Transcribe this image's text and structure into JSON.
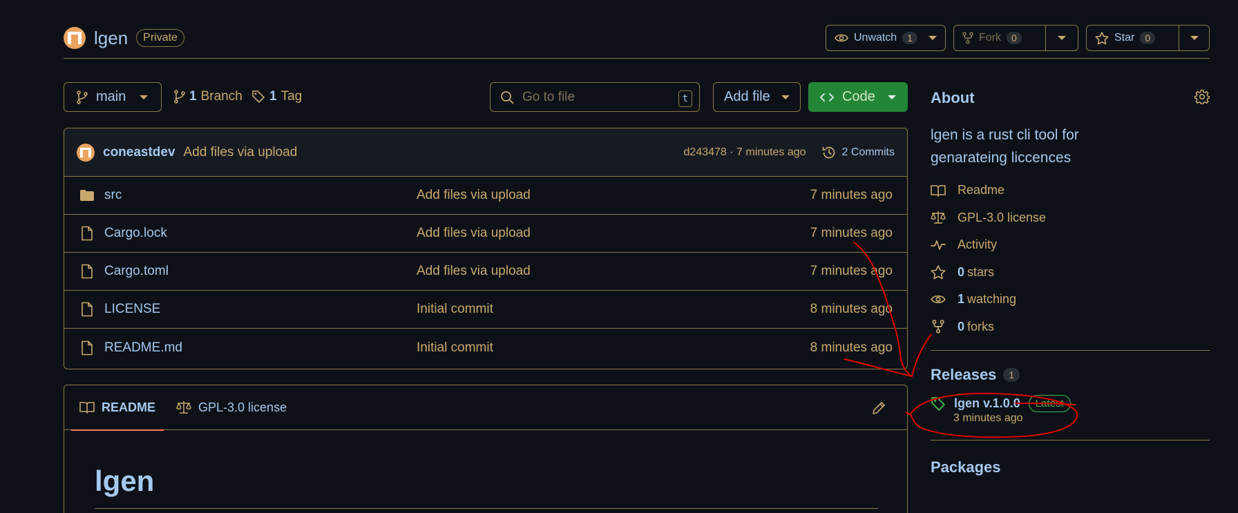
{
  "repo": {
    "name": "lgen",
    "visibility": "Private"
  },
  "header_buttons": {
    "unwatch_label": "Unwatch",
    "unwatch_count": "1",
    "fork_label": "Fork",
    "fork_count": "0",
    "star_label": "Star",
    "star_count": "0"
  },
  "toolbar": {
    "branch": "main",
    "branch_count": "1",
    "branch_label": "Branch",
    "tag_count": "1",
    "tag_label": "Tag",
    "search_placeholder": "Go to file",
    "search_shortcut": "t",
    "add_file_label": "Add file",
    "code_label": "Code"
  },
  "latest_commit": {
    "author": "coneastdev",
    "message": "Add files via upload",
    "meta": "d243478 · 7 minutes ago",
    "commits_label": "2 Commits"
  },
  "files": [
    {
      "name": "src",
      "type": "folder",
      "message": "Add files via upload",
      "date": "7 minutes ago"
    },
    {
      "name": "Cargo.lock",
      "type": "file",
      "message": "Add files via upload",
      "date": "7 minutes ago"
    },
    {
      "name": "Cargo.toml",
      "type": "file",
      "message": "Add files via upload",
      "date": "7 minutes ago"
    },
    {
      "name": "LICENSE",
      "type": "file",
      "message": "Initial commit",
      "date": "8 minutes ago"
    },
    {
      "name": "README.md",
      "type": "file",
      "message": "Initial commit",
      "date": "8 minutes ago"
    }
  ],
  "readme": {
    "tab_readme": "README",
    "tab_license": "GPL-3.0 license",
    "heading": "lgen"
  },
  "about": {
    "title": "About",
    "description": "lgen is a rust cli tool for genarateing liccences",
    "items": [
      {
        "icon": "book-icon",
        "bold": "",
        "label": "Readme"
      },
      {
        "icon": "scale-icon",
        "bold": "",
        "label": "GPL-3.0 license"
      },
      {
        "icon": "pulse-icon",
        "bold": "",
        "label": "Activity"
      },
      {
        "icon": "star-icon",
        "bold": "0",
        "label": "stars"
      },
      {
        "icon": "eye-icon",
        "bold": "1",
        "label": "watching"
      },
      {
        "icon": "fork-icon",
        "bold": "0",
        "label": "forks"
      }
    ]
  },
  "releases": {
    "title": "Releases",
    "count": "1",
    "latest_name": "lgen v.1.0.0",
    "latest_badge": "Latest",
    "latest_date": "3 minutes ago"
  },
  "packages": {
    "title": "Packages"
  },
  "colors": {
    "background": "#0d1117",
    "border": "#8c7a45",
    "link": "#a5c8ee",
    "text": "#c9a96e",
    "code_button": "#238636",
    "latest_badge": "#3fb950",
    "annotation": "#e00000"
  }
}
